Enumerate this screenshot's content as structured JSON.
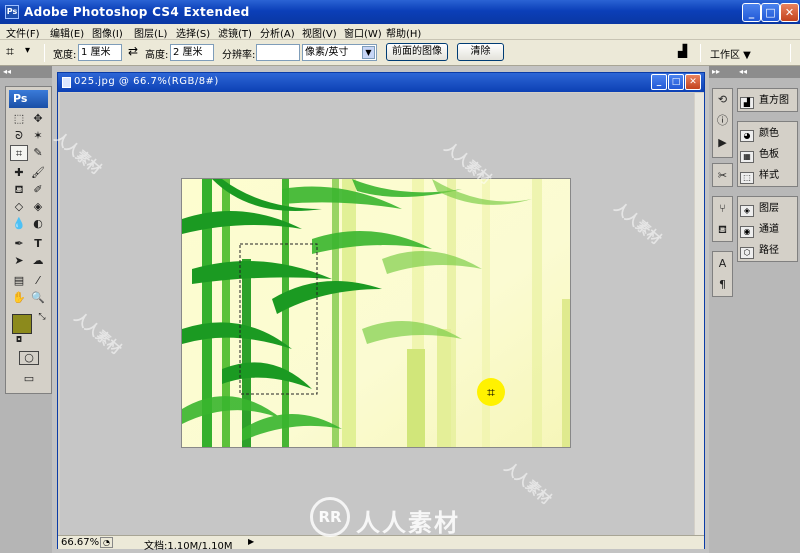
{
  "window": {
    "title": "Adobe Photoshop CS4 Extended",
    "icon": "ps-app-icon",
    "controls": [
      "minimize-icon",
      "maximize-icon",
      "close-icon"
    ]
  },
  "menu": [
    "文件(F)",
    "编辑(E)",
    "图像(I)",
    "图层(L)",
    "选择(S)",
    "滤镜(T)",
    "分析(A)",
    "视图(V)",
    "窗口(W)",
    "帮助(H)"
  ],
  "options": {
    "tool_icon": "crop-icon",
    "width_label": "宽度:",
    "width_value": "1 厘米",
    "swap_icon": "swap-icon",
    "height_label": "高度:",
    "height_value": "2 厘米",
    "resolution_label": "分辨率:",
    "resolution_value": "",
    "unit_value": "像素/英寸",
    "front_image_button": "前面的图像",
    "clear_button": "清除",
    "workspace_label": "工作区 ▼"
  },
  "toolbox": {
    "header": "Ps",
    "selected_tool": "crop-icon",
    "foreground_color": "#8c8a1c",
    "background_color": "#ffffff"
  },
  "document": {
    "title": "025.jpg @ 66.7%(RGB/8#)",
    "controls": [
      "minimize-icon",
      "maximize-icon",
      "close-icon"
    ]
  },
  "status": {
    "zoom": "66.67%",
    "doc_info": "文档:1.10M/1.10M"
  },
  "panels": {
    "group1": [
      "直方图"
    ],
    "group2": [
      "颜色",
      "色板",
      "样式"
    ],
    "group3": [
      "图层",
      "通道",
      "路径"
    ]
  },
  "watermark": {
    "text": "人人素材",
    "logo": "RR"
  },
  "colors": {
    "title_bar": "#0b3fb8",
    "menu_bg": "#ece9d8",
    "panel_bg": "#d4d0c8",
    "canvas_bg": "#c6c6c6",
    "bamboo_green": "#1aa01e",
    "bamboo_yellow": "#f4f7a8",
    "cursor_highlight": "#fff200"
  }
}
